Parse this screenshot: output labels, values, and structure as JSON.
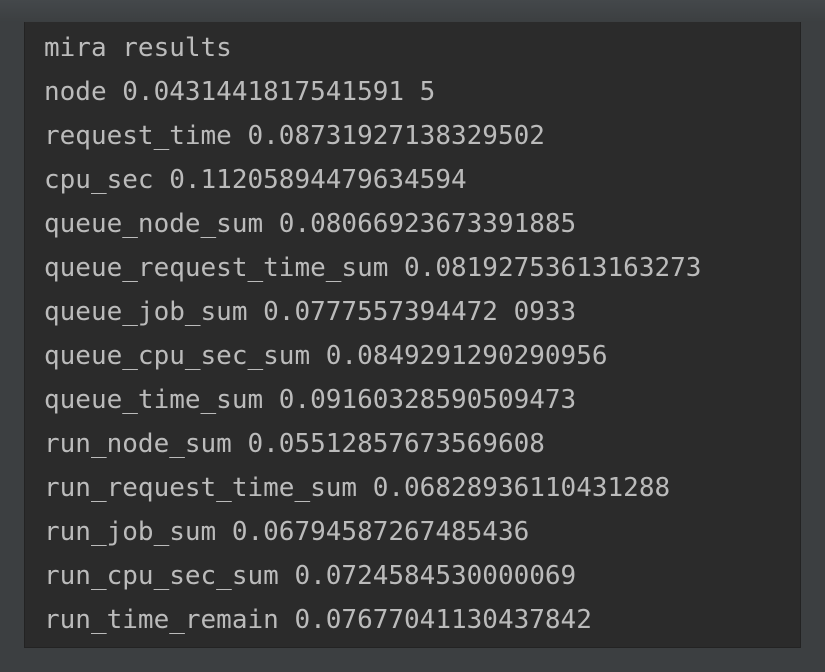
{
  "colors": {
    "window_background": "#3c3f41",
    "console_background": "#2b2b2b",
    "console_text": "#bbbbbb"
  },
  "console": {
    "lines": [
      "mira results",
      "node 0.0431441817541591 5",
      "request_time 0.08731927138329502",
      "cpu_sec 0.11205894479634594",
      "queue_node_sum 0.08066923673391885",
      "queue_request_time_sum 0.08192753613163273",
      "queue_job_sum 0.0777557394472 0933",
      "queue_cpu_sec_sum 0.0849291290290956",
      "queue_time_sum 0.09160328590509473",
      "run_node_sum 0.05512857673569608",
      "run_request_time_sum 0.06828936110431288",
      "run_job_sum 0.06794587267485436",
      "run_cpu_sec_sum 0.0724584530000069",
      "run_time_remain 0.07677041130437842"
    ]
  }
}
